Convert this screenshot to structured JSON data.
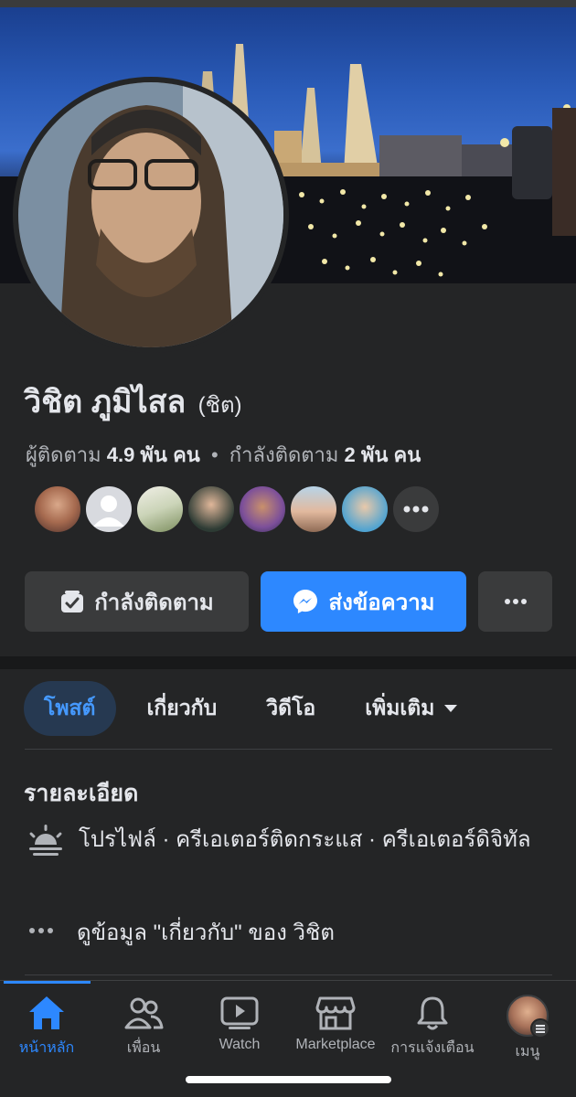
{
  "profile": {
    "name": "วิชิต ภูมิไสล",
    "nickname": "(ชิต)",
    "followers_label": "ผู้ติดตาม",
    "followers_count": "4.9 พัน คน",
    "separator": "•",
    "following_label": "กำลังติดตาม",
    "following_count": "2 พัน คน"
  },
  "friends": {
    "avatars": [
      "friend-1",
      "friend-2",
      "friend-3",
      "friend-4",
      "friend-5",
      "friend-6",
      "friend-7"
    ],
    "more_icon": "ellipsis-icon"
  },
  "actions": {
    "following_label": "กำลังติดตาม",
    "message_label": "ส่งข้อความ",
    "more_icon": "ellipsis-icon"
  },
  "tabs": [
    {
      "label": "โพสต์",
      "active": true
    },
    {
      "label": "เกี่ยวกับ",
      "active": false
    },
    {
      "label": "วิดีโอ",
      "active": false
    },
    {
      "label": "เพิ่มเติม",
      "active": false
    }
  ],
  "details": {
    "heading": "รายละเอียด",
    "profile_line": "โปรไฟล์ · ครีเอเตอร์ติดกระแส · ครีเอเตอร์ดิจิทัล",
    "about_line": "ดูข้อมูล \"เกี่ยวกับ\" ของ วิชิต"
  },
  "nav": [
    {
      "label": "หน้าหลัก",
      "icon": "home-icon",
      "active": true
    },
    {
      "label": "เพื่อน",
      "icon": "friends-icon",
      "active": false
    },
    {
      "label": "Watch",
      "icon": "watch-icon",
      "active": false
    },
    {
      "label": "Marketplace",
      "icon": "marketplace-icon",
      "active": false
    },
    {
      "label": "การแจ้งเตือน",
      "icon": "bell-icon",
      "active": false
    },
    {
      "label": "เมนู",
      "icon": "menu-avatar-icon",
      "active": false
    }
  ],
  "colors": {
    "background": "#242526",
    "accent": "#2d88ff",
    "button": "#3a3b3c"
  }
}
